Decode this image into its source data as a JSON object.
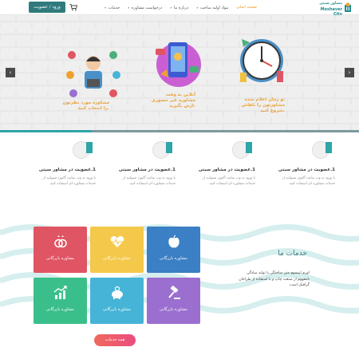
{
  "header": {
    "login_label": "ورود / عضویت",
    "nav": [
      {
        "label": "صفحه اصلی",
        "active": true,
        "dropdown": false
      },
      {
        "label": "مواد اولیه ساخت",
        "active": false,
        "dropdown": true
      },
      {
        "label": "درباره ما",
        "active": false,
        "dropdown": true
      },
      {
        "label": "درخواست مشاوره",
        "active": false,
        "dropdown": true
      },
      {
        "label": "خدمات",
        "active": false,
        "dropdown": true
      }
    ],
    "logo_line1": "مشاور سیتی",
    "logo_line2": "Moshaver City",
    "brand_color": "#2f7a7d",
    "accent_color": "#e8a23a"
  },
  "slider": {
    "slides": [
      {
        "caption_l1": "تو زمان اعلام شده",
        "caption_l2": "مشاورتون را باهاش",
        "caption_l3": "شروع کنید."
      },
      {
        "caption_l1": "آنلاین یه وقت",
        "caption_l2": "مشاوره غیر حضوری",
        "caption_l3": "ازش بگیرید."
      },
      {
        "caption_l1": "مشاوره مورد نظرتون",
        "caption_l2": "را انتخاب کنید."
      }
    ],
    "prev_icon": "chevron-left-icon",
    "next_icon": "chevron-right-icon",
    "dots": 5,
    "active_dot": 2
  },
  "features": [
    {
      "title": "1.عضویت در مشاور سیتی",
      "desc_l1": "با ورود به وب سایت آکنون میتوانید از",
      "desc_l2": "خدمات مشاوره ای استفاده کنید."
    },
    {
      "title": "1.عضویت در مشاور سیتی",
      "desc_l1": "با ورود به وب سایت آکنون میتوانید از",
      "desc_l2": "خدمات مشاوره ای استفاده کنید."
    },
    {
      "title": "1.عضویت در مشاور سیتی",
      "desc_l1": "با ورود به وب سایت آکنون میتوانید از",
      "desc_l2": "خدمات مشاوره ای استفاده کنید."
    },
    {
      "title": "1.عضویت در مشاور سیتی",
      "desc_l1": "با ورود به وب سایت آکنون میتوانید از",
      "desc_l2": "خدمات مشاوره ای استفاده کنید."
    }
  ],
  "services": {
    "title": "خدمات ما",
    "desc_l1": "لورم ایپسوم متن ساختگی با تولید سادگی",
    "desc_l2": "نامفهوم از صنعت چاپ و با استفاده از طراحان",
    "desc_l3": "گرافیک است.",
    "items": [
      {
        "label": "مشاوره بازرگانی",
        "icon": "rings-icon",
        "color": "#e05563"
      },
      {
        "label": "مشاوره بازرگانی",
        "icon": "heartbeat-icon",
        "color": "#f4c84a"
      },
      {
        "label": "مشاوره بازرگانی",
        "icon": "apple-icon",
        "color": "#3b7fc4"
      },
      {
        "label": "مشاوره بازرگانی",
        "icon": "chart-up-icon",
        "color": "#3bbf8a"
      },
      {
        "label": "مشاوره بازرگانی",
        "icon": "piggy-bank-icon",
        "color": "#46b4d6"
      },
      {
        "label": "مشاوره بازرگانی",
        "icon": "gavel-icon",
        "color": "#9b6fcf"
      }
    ],
    "all_label": "همه خدمات"
  }
}
